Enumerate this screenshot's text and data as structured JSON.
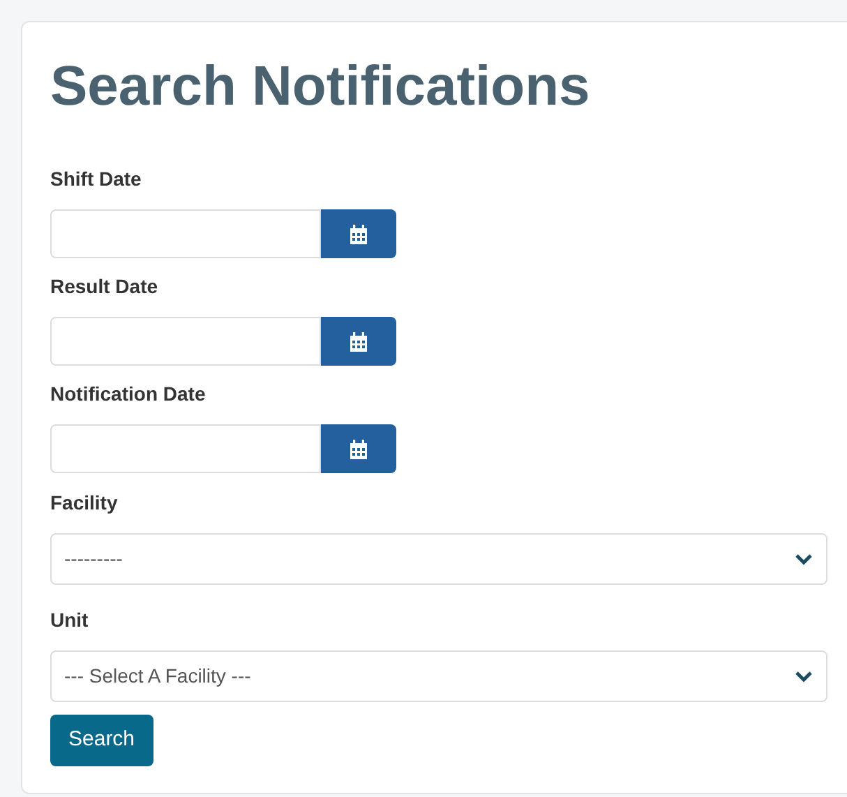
{
  "title": "Search Notifications",
  "date_fields": [
    {
      "label": "Shift Date"
    },
    {
      "label": "Result Date"
    },
    {
      "label": "Notification Date"
    }
  ],
  "selects": [
    {
      "label": "Facility",
      "value": "---------"
    },
    {
      "label": "Unit",
      "value": "--- Select A Facility ---"
    }
  ],
  "submit_button": "Search"
}
